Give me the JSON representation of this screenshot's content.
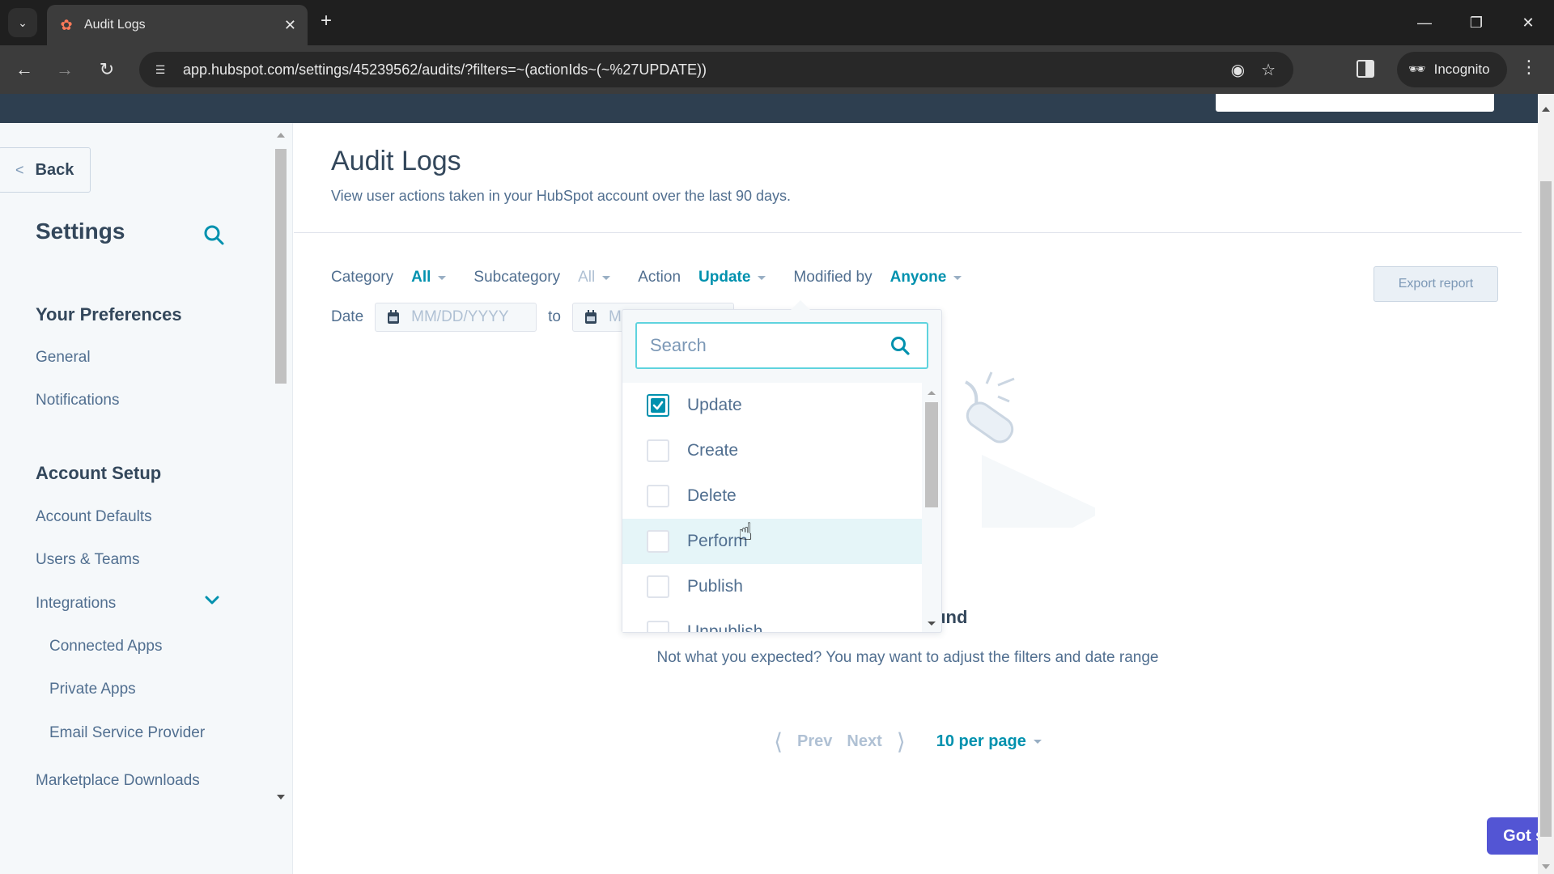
{
  "browser": {
    "tab_title": "Audit Logs",
    "url": "app.hubspot.com/settings/45239562/audits/?filters=~(actionIds~(~%27UPDATE))",
    "incognito_label": "Incognito"
  },
  "sidebar": {
    "back_label": "Back",
    "title": "Settings",
    "sections": [
      {
        "heading": "Your Preferences",
        "items": [
          "General",
          "Notifications"
        ]
      },
      {
        "heading": "Account Setup",
        "items": [
          "Account Defaults",
          "Users & Teams",
          "Integrations"
        ]
      }
    ],
    "integrations_children": [
      "Connected Apps",
      "Private Apps",
      "Email Service Provider"
    ],
    "after_items": [
      "Marketplace Downloads"
    ]
  },
  "main": {
    "title": "Audit Logs",
    "subtitle": "View user actions taken in your HubSpot account over the last 90 days.",
    "filters": {
      "category_label": "Category",
      "category_value": "All",
      "subcategory_label": "Subcategory",
      "subcategory_value": "All",
      "action_label": "Action",
      "action_value": "Update",
      "modified_by_label": "Modified by",
      "modified_by_value": "Anyone",
      "date_label": "Date",
      "date_from_placeholder": "MM/DD/YYYY",
      "date_to_label": "to",
      "date_to_placeholder": "MM/DD/YYYY"
    },
    "export_label": "Export report",
    "empty_title": "No logs found",
    "empty_subtitle": "Not what you expected? You may want to adjust the filters and date range",
    "pager": {
      "prev": "Prev",
      "next": "Next",
      "per_page": "10 per page"
    },
    "feedback_label": "Got some feedback? Let us know here"
  },
  "action_dropdown": {
    "search_placeholder": "Search",
    "options": [
      {
        "label": "Update",
        "checked": true
      },
      {
        "label": "Create",
        "checked": false
      },
      {
        "label": "Delete",
        "checked": false
      },
      {
        "label": "Perform",
        "checked": false
      },
      {
        "label": "Publish",
        "checked": false
      },
      {
        "label": "Unpublish",
        "checked": false
      }
    ]
  },
  "colors": {
    "accent": "#0091ae",
    "heading": "#33475b",
    "text": "#516f90",
    "nav_bar": "#2e3f50",
    "feedback": "#5355d4",
    "focus_ring": "#5fd3de"
  }
}
